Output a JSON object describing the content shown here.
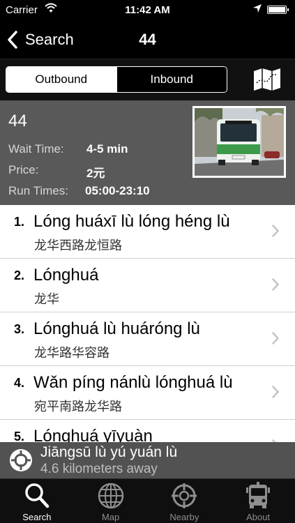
{
  "status_bar": {
    "carrier": "Carrier",
    "time": "11:42 AM"
  },
  "nav": {
    "back_label": "Search",
    "title": "44"
  },
  "segments": {
    "outbound": "Outbound",
    "inbound": "Inbound",
    "selected": "outbound"
  },
  "route": {
    "number": "44",
    "wait_label": "Wait Time:",
    "wait_value": "4-5 min",
    "price_label": "Price:",
    "price_value": "2元",
    "run_label": "Run Times:",
    "run_value": "05:00-23:10"
  },
  "stops": [
    {
      "num": "1.",
      "name": "Lóng huáxī lù lóng héng lù",
      "chinese": "龙华西路龙恒路"
    },
    {
      "num": "2.",
      "name": "Lónghuá",
      "chinese": "龙华"
    },
    {
      "num": "3.",
      "name": "Lónghuá lù huáróng lù",
      "chinese": "龙华路华容路"
    },
    {
      "num": "4.",
      "name": "Wǎn píng nánlù lónghuá lù",
      "chinese": "宛平南路龙华路"
    },
    {
      "num": "5.",
      "name": "Lónghuá yīyuàn",
      "chinese": ""
    }
  ],
  "nearby": {
    "name": "Jiāngsū lù yú yuán lù",
    "distance": "4.6 kilometers away"
  },
  "tabs": [
    {
      "label": "Search",
      "icon": "search-icon",
      "active": true
    },
    {
      "label": "Map",
      "icon": "globe-icon",
      "active": false
    },
    {
      "label": "Nearby",
      "icon": "target-icon",
      "active": false
    },
    {
      "label": "About",
      "icon": "bus-icon",
      "active": false
    }
  ],
  "colors": {
    "info_panel": "#595959",
    "nearby_bar": "#555555",
    "tab_active": "#ffffff",
    "tab_inactive": "#8e8e8e"
  }
}
